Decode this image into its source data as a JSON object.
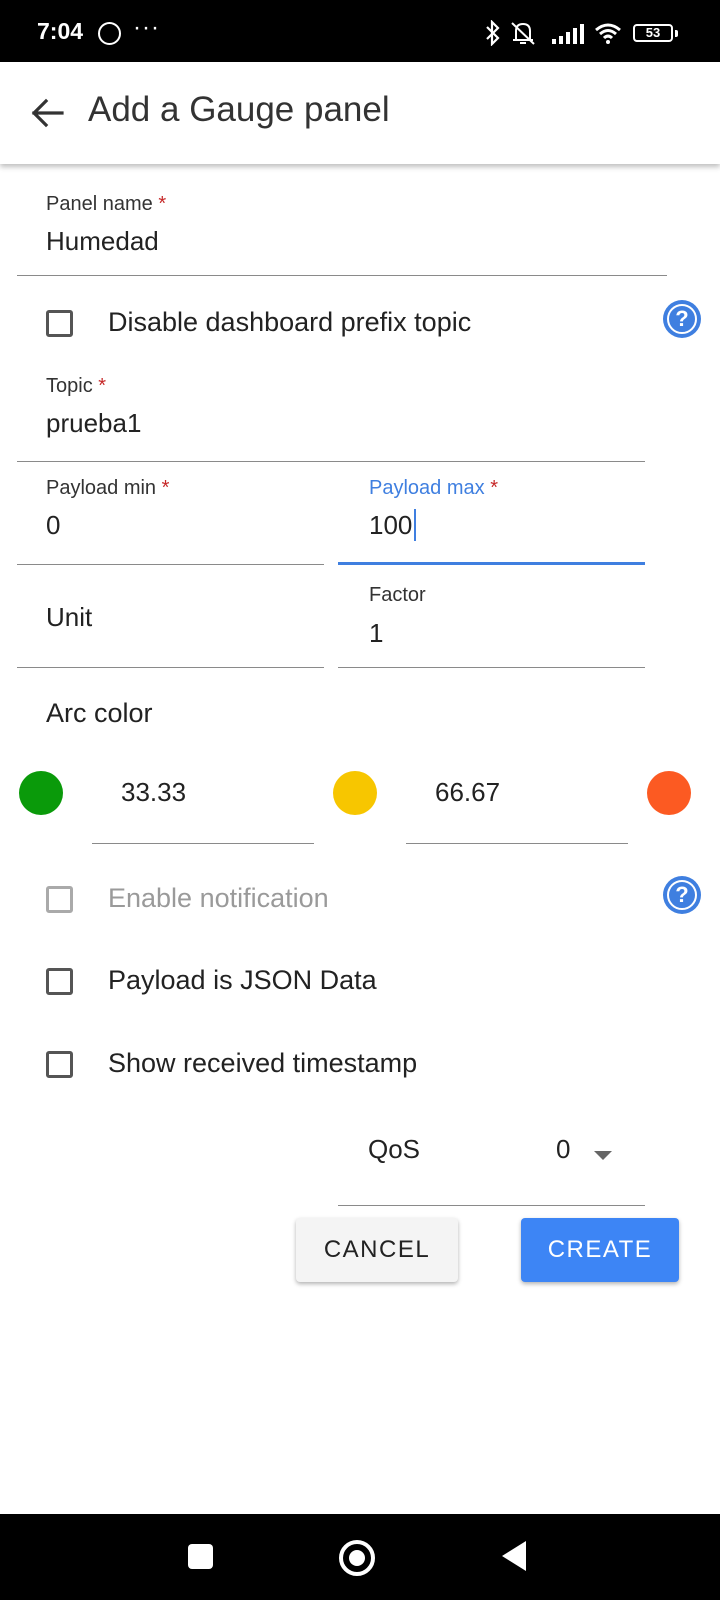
{
  "status_bar": {
    "time": "7:04",
    "dots": "···",
    "battery": "53"
  },
  "app_bar": {
    "title": "Add a Gauge panel"
  },
  "form": {
    "panel_name": {
      "label": "Panel name",
      "required_mark": "*",
      "value": "Humedad"
    },
    "disable_prefix": {
      "label": "Disable dashboard prefix topic",
      "checked": false
    },
    "topic": {
      "label": "Topic",
      "required_mark": "*",
      "value": "prueba1"
    },
    "payload_min": {
      "label": "Payload min",
      "required_mark": "*",
      "value": "0"
    },
    "payload_max": {
      "label": "Payload max",
      "required_mark": "*",
      "value": "100"
    },
    "unit": {
      "placeholder": "Unit"
    },
    "factor": {
      "label": "Factor",
      "value": "1"
    },
    "arc_color": {
      "label": "Arc color",
      "colors": [
        "#0a9a0a",
        "#f7c600",
        "#fc5a22"
      ],
      "threshold_1": "33.33",
      "threshold_2": "66.67"
    },
    "enable_notification": {
      "label": "Enable notification",
      "checked": false,
      "disabled": true
    },
    "payload_json": {
      "label": "Payload is JSON Data",
      "checked": false
    },
    "show_timestamp": {
      "label": "Show received timestamp",
      "checked": false
    },
    "qos": {
      "label": "QoS",
      "value": "0"
    }
  },
  "buttons": {
    "cancel": "CANCEL",
    "create": "CREATE"
  },
  "help_icon_glyph": "?",
  "colors": {
    "accent": "#3f7fe0",
    "create_button": "#3d85f5",
    "required": "#c62828"
  }
}
